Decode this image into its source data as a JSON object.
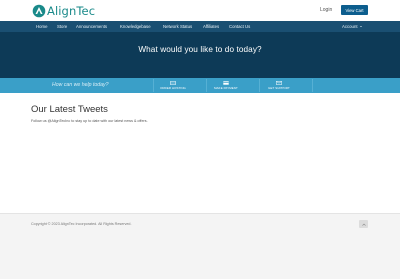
{
  "header": {
    "logo_text": "AlignTec",
    "login_label": "Login",
    "view_cart_label": "View Cart"
  },
  "nav": {
    "items": [
      {
        "label": "Home"
      },
      {
        "label": "Store"
      },
      {
        "label": "Announcements"
      },
      {
        "label": "Knowledgebase"
      },
      {
        "label": "Network Status"
      },
      {
        "label": "Affiliates"
      },
      {
        "label": "Contact Us"
      }
    ],
    "account_label": "Account"
  },
  "hero": {
    "title": "What would you like to do today?"
  },
  "actions": {
    "help_label": "How can we help today?",
    "items": [
      {
        "label": "ORDER HOSTING",
        "icon": "server-icon"
      },
      {
        "label": "MAKE PAYMENT",
        "icon": "credit-card-icon"
      },
      {
        "label": "GET SUPPORT",
        "icon": "envelope-icon"
      }
    ]
  },
  "tweets": {
    "title": "Our Latest Tweets",
    "subtitle": "Follow us @AlignTecInc to stay up to date with our latest news & offers."
  },
  "footer": {
    "copyright": "Copyright © 2023 AlignTec Incorporated. All Rights Reserved."
  },
  "colors": {
    "brand_teal": "#1a8a8a",
    "nav_bg": "#1a4f72",
    "hero_bg": "#0d3a57",
    "action_bg": "#3a9fc8",
    "cart_btn": "#0d5e8e"
  }
}
